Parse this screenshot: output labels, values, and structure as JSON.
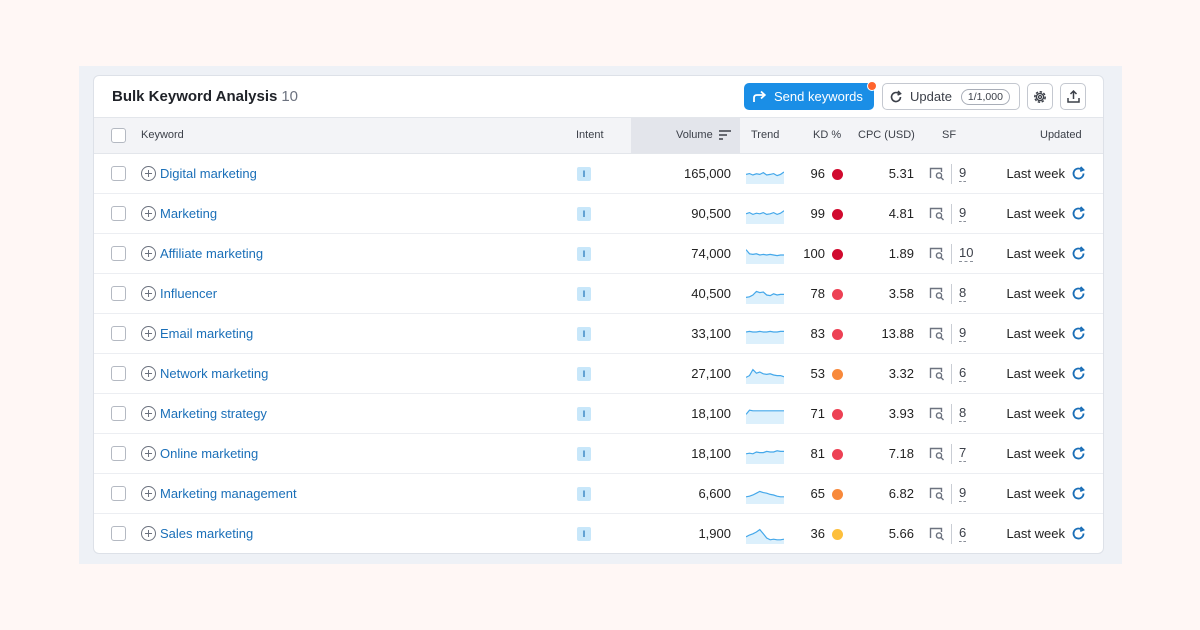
{
  "header": {
    "title": "Bulk Keyword Analysis",
    "count": "10",
    "send_label": "Send keywords",
    "update_label": "Update",
    "update_limit": "1/1,000"
  },
  "columns": {
    "keyword": "Keyword",
    "intent": "Intent",
    "volume": "Volume",
    "trend": "Trend",
    "kd": "KD %",
    "cpc": "CPC (USD)",
    "sf": "SF",
    "updated": "Updated"
  },
  "colors": {
    "accent": "#1a8ee6",
    "link": "#1a6fb8",
    "kd_very_hard": "#d10a2e",
    "kd_hard": "#ed4154",
    "kd_medium": "#f8893b",
    "kd_possible": "#fdbf3c"
  },
  "icons": [
    "send-icon",
    "refresh-icon",
    "gear-icon",
    "export-icon",
    "add-keyword-icon",
    "serp-icon",
    "sort-icon"
  ],
  "rows": [
    {
      "keyword": "Digital marketing",
      "intent": "I",
      "volume": "165,000",
      "trend": [
        0.55,
        0.62,
        0.5,
        0.6,
        0.55,
        0.7,
        0.5,
        0.55,
        0.62,
        0.45,
        0.55,
        0.75
      ],
      "kd": "96",
      "kd_color": "#d10a2e",
      "cpc": "5.31",
      "sf": "9",
      "updated": "Last week"
    },
    {
      "keyword": "Marketing",
      "intent": "I",
      "volume": "90,500",
      "trend": [
        0.6,
        0.7,
        0.55,
        0.65,
        0.6,
        0.7,
        0.55,
        0.6,
        0.7,
        0.55,
        0.65,
        0.85
      ],
      "kd": "99",
      "kd_color": "#d10a2e",
      "cpc": "4.81",
      "sf": "9",
      "updated": "Last week"
    },
    {
      "keyword": "Affiliate marketing",
      "intent": "I",
      "volume": "74,000",
      "trend": [
        0.95,
        0.6,
        0.55,
        0.6,
        0.5,
        0.55,
        0.5,
        0.55,
        0.5,
        0.45,
        0.5,
        0.5
      ],
      "kd": "100",
      "kd_color": "#d10a2e",
      "cpc": "1.89",
      "sf": "10",
      "updated": "Last week"
    },
    {
      "keyword": "Influencer",
      "intent": "I",
      "volume": "40,500",
      "trend": [
        0.3,
        0.35,
        0.5,
        0.8,
        0.7,
        0.75,
        0.5,
        0.45,
        0.6,
        0.5,
        0.55,
        0.55
      ],
      "kd": "78",
      "kd_color": "#ed4154",
      "cpc": "3.58",
      "sf": "8",
      "updated": "Last week"
    },
    {
      "keyword": "Email marketing",
      "intent": "I",
      "volume": "33,100",
      "trend": [
        0.75,
        0.8,
        0.75,
        0.75,
        0.8,
        0.75,
        0.75,
        0.8,
        0.75,
        0.75,
        0.8,
        0.8
      ],
      "kd": "83",
      "kd_color": "#ed4154",
      "cpc": "13.88",
      "sf": "9",
      "updated": "Last week"
    },
    {
      "keyword": "Network marketing",
      "intent": "I",
      "volume": "27,100",
      "trend": [
        0.3,
        0.45,
        0.95,
        0.65,
        0.75,
        0.6,
        0.55,
        0.6,
        0.5,
        0.45,
        0.45,
        0.35
      ],
      "kd": "53",
      "kd_color": "#f8893b",
      "cpc": "3.32",
      "sf": "6",
      "updated": "Last week"
    },
    {
      "keyword": "Marketing strategy",
      "intent": "I",
      "volume": "18,100",
      "trend": [
        0.55,
        0.9,
        0.85,
        0.85,
        0.85,
        0.85,
        0.85,
        0.85,
        0.85,
        0.85,
        0.85,
        0.85
      ],
      "kd": "71",
      "kd_color": "#ed4154",
      "cpc": "3.93",
      "sf": "8",
      "updated": "Last week"
    },
    {
      "keyword": "Online marketing",
      "intent": "I",
      "volume": "18,100",
      "trend": [
        0.6,
        0.65,
        0.6,
        0.75,
        0.7,
        0.7,
        0.8,
        0.75,
        0.75,
        0.85,
        0.8,
        0.8
      ],
      "kd": "81",
      "kd_color": "#ed4154",
      "cpc": "7.18",
      "sf": "7",
      "updated": "Last week"
    },
    {
      "keyword": "Marketing management",
      "intent": "I",
      "volume": "6,600",
      "trend": [
        0.35,
        0.4,
        0.5,
        0.65,
        0.8,
        0.7,
        0.65,
        0.55,
        0.5,
        0.4,
        0.35,
        0.35
      ],
      "kd": "65",
      "kd_color": "#f8893b",
      "cpc": "6.82",
      "sf": "9",
      "updated": "Last week"
    },
    {
      "keyword": "Sales marketing",
      "intent": "I",
      "volume": "1,900",
      "trend": [
        0.35,
        0.5,
        0.6,
        0.75,
        0.95,
        0.6,
        0.25,
        0.1,
        0.15,
        0.1,
        0.1,
        0.15
      ],
      "kd": "36",
      "kd_color": "#fdbf3c",
      "cpc": "5.66",
      "sf": "6",
      "updated": "Last week"
    }
  ]
}
